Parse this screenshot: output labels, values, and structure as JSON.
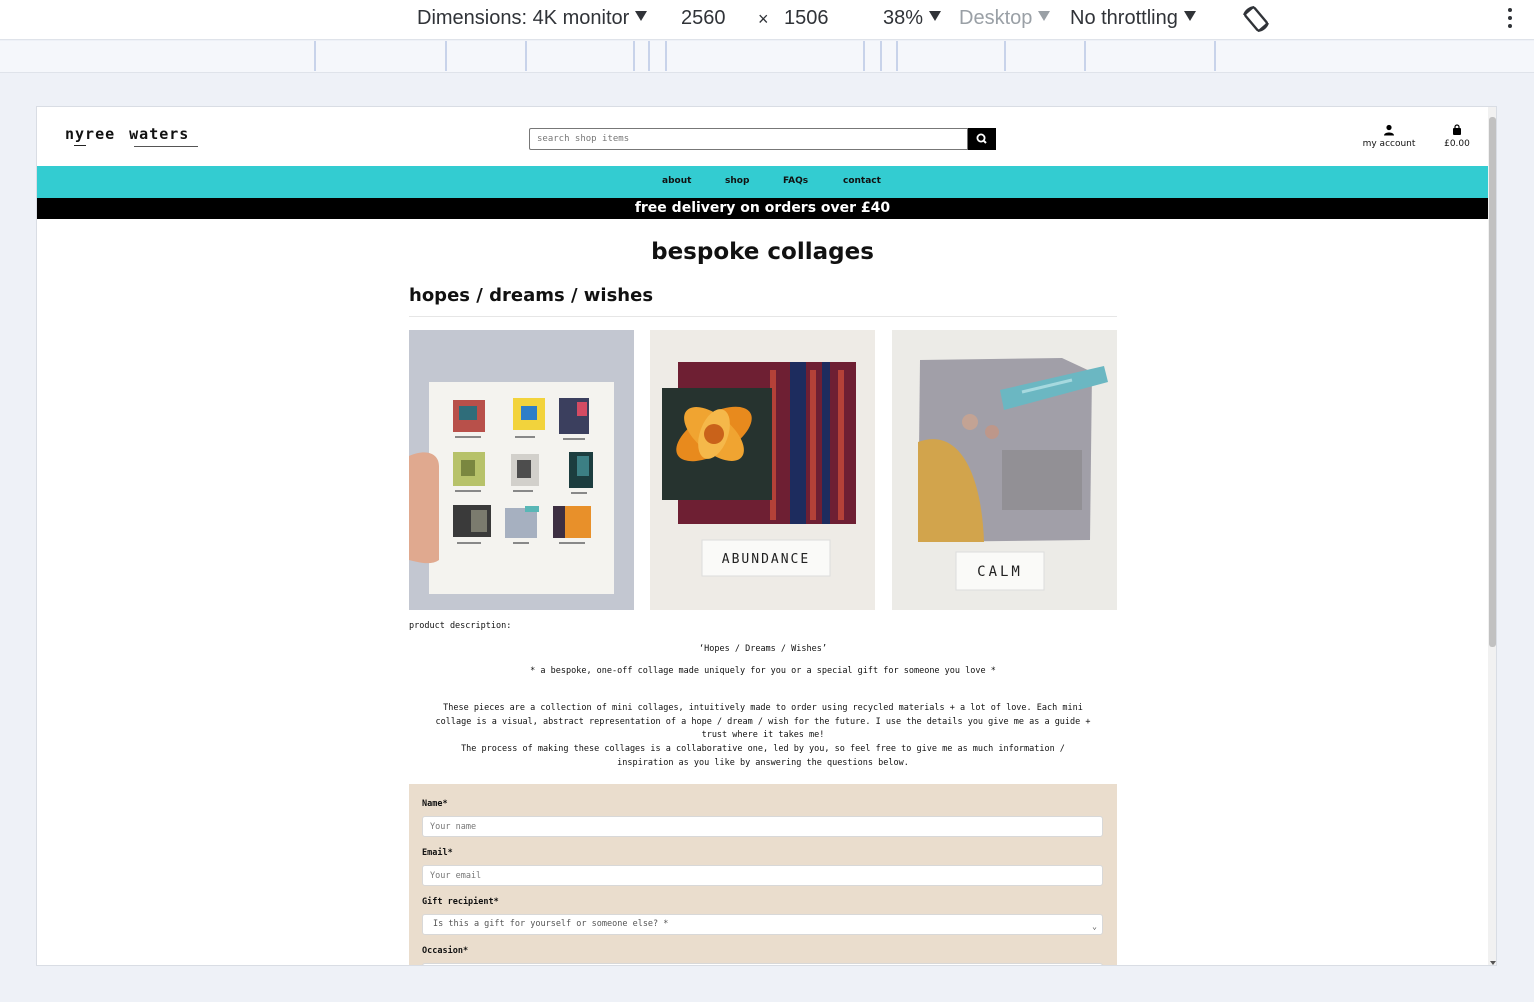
{
  "devtools": {
    "dimensions_label": "Dimensions: 4K monitor",
    "width": "2560",
    "times": "×",
    "height": "1506",
    "zoom": "38%",
    "device_type": "Desktop",
    "throttling": "No throttling"
  },
  "site": {
    "logo_word1": "nyree",
    "logo_word2": "waters",
    "search_placeholder": "search shop items",
    "account_label": "my account",
    "cart_total": "£0.00",
    "nav": [
      "about",
      "shop",
      "FAQs",
      "contact"
    ],
    "promo": "free delivery on orders over £40",
    "accent_color": "#33ccd1"
  },
  "page": {
    "title": "bespoke collages",
    "product_title": "hopes / dreams / wishes",
    "images": [
      {
        "caption_text": ""
      },
      {
        "caption_text": "ABUNDANCE"
      },
      {
        "caption_text": "CALM"
      }
    ],
    "description_label": "product description:",
    "desc_quote": "‘Hopes / Dreams / Wishes’",
    "desc_tagline": "* a bespoke, one-off collage made uniquely for you or a special gift for someone you love *",
    "desc_para_line1": "These pieces are a collection of mini collages, intuitively made to order using recycled materials + a lot of love. Each mini",
    "desc_para_line2": "collage is a visual, abstract representation of a hope / dream / wish for the future. I use the details you give me as a guide +",
    "desc_para_line3": "trust where it takes me!",
    "desc_para_line4": "The process of making these collages is a collaborative one, led by you, so feel free to give me as much information /",
    "desc_para_line5": "inspiration as you like by answering the questions below."
  },
  "form": {
    "name_label": "Name*",
    "name_placeholder": "Your name",
    "email_label": "Email*",
    "email_placeholder": "Your email",
    "gift_label": "Gift recipient*",
    "gift_selected": "Is this a gift for yourself or someone else? *",
    "occasion_label": "Occasion*",
    "panel_color": "#eaddcd"
  }
}
